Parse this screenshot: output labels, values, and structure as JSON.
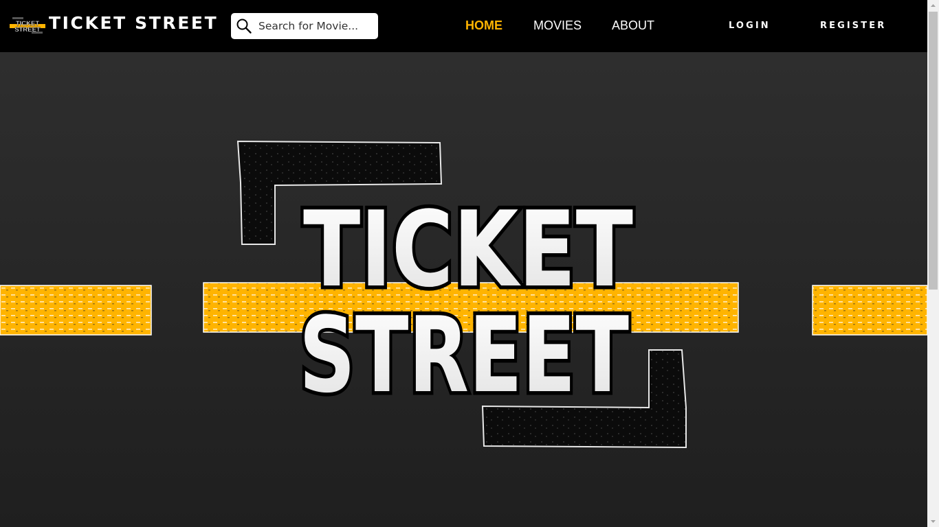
{
  "brand": {
    "name": "TICKET STREET",
    "logo_text": "TICKET STREET"
  },
  "search": {
    "placeholder": "Search for Movie...",
    "value": "",
    "icon": "search-icon"
  },
  "nav": {
    "items": [
      {
        "label": "HOME",
        "active": true
      },
      {
        "label": "MOVIES",
        "active": false
      },
      {
        "label": "ABOUT",
        "active": false
      }
    ]
  },
  "auth": {
    "login_label": "LOGIN",
    "register_label": "REGISTER"
  },
  "hero": {
    "logo_line1": "TICKET",
    "logo_line2": "STREET"
  },
  "colors": {
    "accent": "#ffb400",
    "header_bg": "#000000",
    "hero_bg": "#2a2a2a"
  }
}
